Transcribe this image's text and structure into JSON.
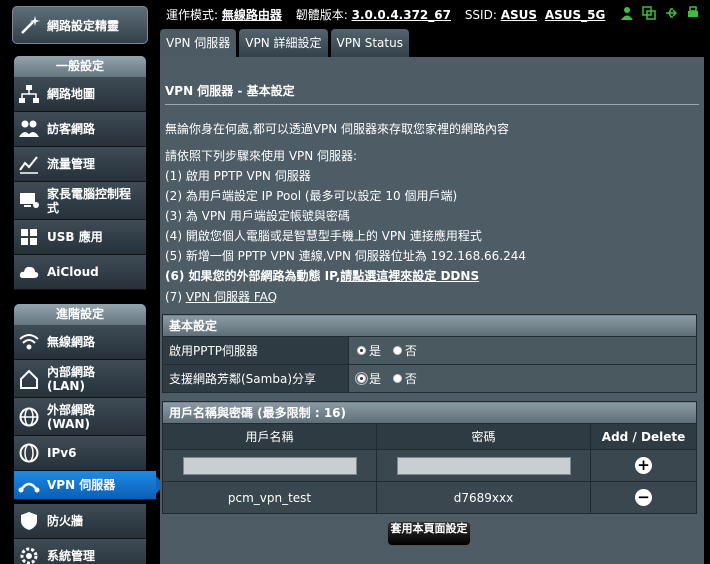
{
  "sidebar": {
    "qis_label": "網路設定精靈",
    "general_header": "一般設定",
    "general_items": [
      {
        "label": "網路地圖",
        "icon": "network-map-icon"
      },
      {
        "label": "訪客網路",
        "icon": "guest-network-icon"
      },
      {
        "label": "流量管理",
        "icon": "traffic-manager-icon"
      },
      {
        "label": "家長電腦控制程式",
        "icon": "parental-control-icon"
      },
      {
        "label": "USB 應用",
        "icon": "usb-icon"
      },
      {
        "label": "AiCloud",
        "icon": "cloud-icon"
      }
    ],
    "advanced_header": "進階設定",
    "advanced_items": [
      {
        "label": "無線網路",
        "icon": "wireless-icon"
      },
      {
        "label": "內部網路\n(LAN)",
        "icon": "lan-icon"
      },
      {
        "label": "外部網路\n(WAN)",
        "icon": "wan-icon"
      },
      {
        "label": "IPv6",
        "icon": "ipv6-icon"
      },
      {
        "label": "VPN 伺服器",
        "icon": "vpn-icon"
      },
      {
        "label": "防火牆",
        "icon": "firewall-icon"
      },
      {
        "label": "系統管理",
        "icon": "administration-icon"
      }
    ]
  },
  "topbar": {
    "mode_label": "運作模式:",
    "mode_value": "無線路由器",
    "firmware_label": "韌體版本:",
    "firmware_value": "3.0.0.4.372_67",
    "ssid_label": "SSID:",
    "ssid_values": [
      "ASUS",
      "ASUS_5G"
    ]
  },
  "tabs": [
    "VPN 伺服器",
    "VPN 詳細設定",
    "VPN Status"
  ],
  "main": {
    "title": "VPN 伺服器 - 基本設定",
    "intro": "無論你身在何處,都可以透過VPN 伺服器來存取您家裡的網路內容",
    "steps_title": "請依照下列步驟來使用 VPN 伺服器:",
    "step1": "(1) 啟用 PPTP VPN 伺服器",
    "step2": "(2) 為用戶端設定 IP Pool (最多可以設定 10 個用戶端)",
    "step3": "(3) 為 VPN 用戶端設定帳號與密碼",
    "step4": "(4) 開啟您個人電腦或是智慧型手機上的 VPN 連接應用程式",
    "step5": "(5) 新增一個 PPTP VPN 連線,VPN 伺服器位址為 192.168.66.244",
    "step6_prefix": "(6) 如果您的外部網路為動態 IP,",
    "step6_link": "請點選這裡來設定 DDNS",
    "step7_prefix": "(7) ",
    "step7_link": "VPN 伺服器 FAQ"
  },
  "basic_settings": {
    "header": "基本設定",
    "rows": [
      {
        "label": "啟用PPTP伺服器",
        "yes": "是",
        "no": "否"
      },
      {
        "label": "支援網路芳鄰(Samba)分享",
        "yes": "是",
        "no": "否"
      }
    ]
  },
  "users": {
    "header": "用戶名稱與密碼 (最多限制 : 16)",
    "col_username": "用戶名稱",
    "col_password": "密碼",
    "col_action": "Add / Delete",
    "entries": [
      {
        "username": "pcm_vpn_test",
        "password": "d7689xxx"
      }
    ]
  },
  "apply_label": "套用本頁面設定"
}
